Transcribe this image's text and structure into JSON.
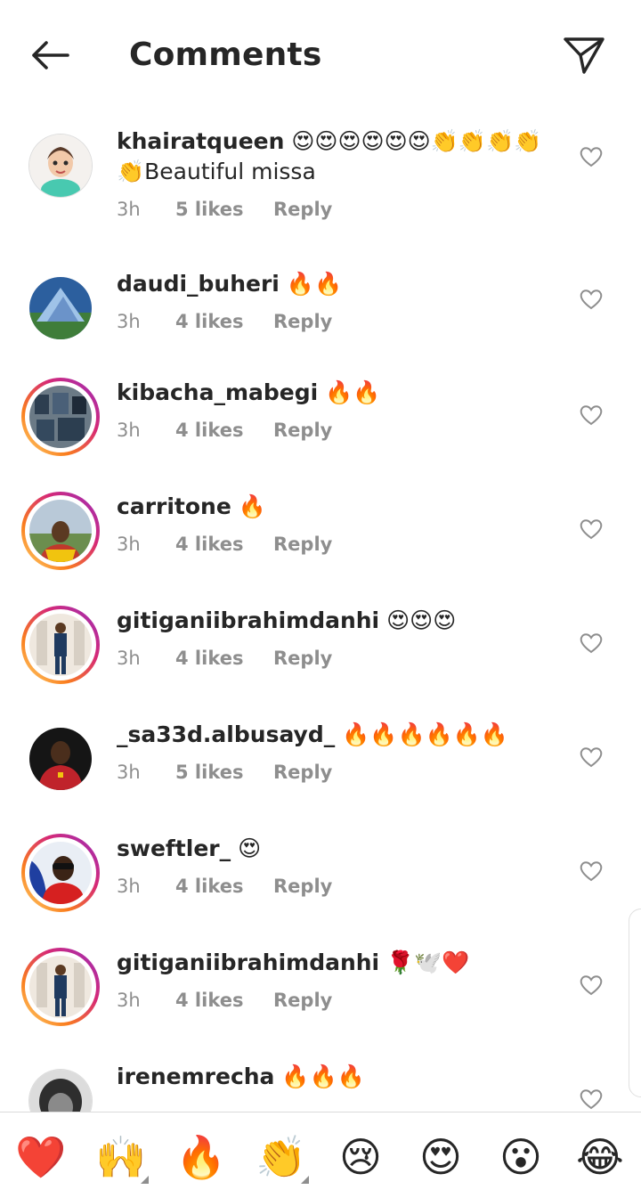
{
  "header": {
    "title": "Comments",
    "back_icon": "back-arrow-icon",
    "send_icon": "paper-plane-icon"
  },
  "comments": [
    {
      "username": "khairatqueen",
      "text": "😍😍😍😍😍😍👏👏👏👏👏Beautiful missa",
      "time": "3h",
      "likes": "5 likes",
      "reply": "Reply",
      "story_ring": false
    },
    {
      "username": "daudi_buheri",
      "text": "🔥🔥",
      "time": "3h",
      "likes": "4 likes",
      "reply": "Reply",
      "story_ring": false
    },
    {
      "username": "kibacha_mabegi",
      "text": "🔥🔥",
      "time": "3h",
      "likes": "4 likes",
      "reply": "Reply",
      "story_ring": true
    },
    {
      "username": "carritone",
      "text": "🔥",
      "time": "3h",
      "likes": "4 likes",
      "reply": "Reply",
      "story_ring": true
    },
    {
      "username": "gitiganiibrahimdanhi",
      "text": "😍😍😍",
      "time": "3h",
      "likes": "4 likes",
      "reply": "Reply",
      "story_ring": true
    },
    {
      "username": "_sa33d.albusayd_",
      "text": "🔥🔥🔥🔥🔥🔥",
      "time": "3h",
      "likes": "5 likes",
      "reply": "Reply",
      "story_ring": false
    },
    {
      "username": "sweftler_",
      "text": "😍",
      "time": "3h",
      "likes": "4 likes",
      "reply": "Reply",
      "story_ring": true
    },
    {
      "username": "gitiganiibrahimdanhi",
      "text": "🌹🕊️❤️",
      "time": "3h",
      "likes": "4 likes",
      "reply": "Reply",
      "story_ring": true
    },
    {
      "username": "irenemrecha",
      "text": "🔥🔥🔥",
      "time": "",
      "likes": "",
      "reply": "",
      "story_ring": false
    }
  ],
  "emoji_bar": [
    "❤️",
    "🙌",
    "🔥",
    "👏",
    "😢",
    "😍",
    "😮",
    "😂"
  ],
  "colors": {
    "text": "#262626",
    "meta": "#8e8e8e",
    "ring_start": "#feda75",
    "ring_end": "#962fbf"
  }
}
